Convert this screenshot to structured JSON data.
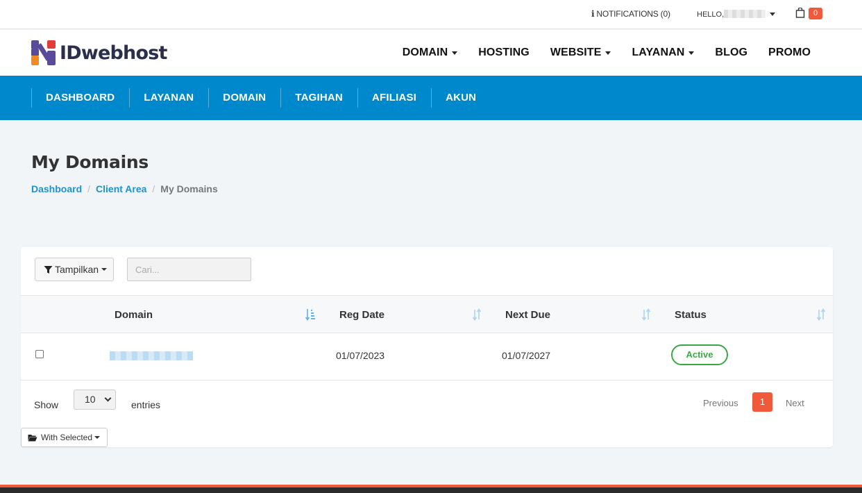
{
  "topbar": {
    "notifications_label": "NOTIFICATIONS (0)",
    "hello_label": "HELLO,",
    "cart_count": "0"
  },
  "header": {
    "logo_text": "IDwebhost",
    "nav": [
      {
        "label": "DOMAIN",
        "dropdown": true
      },
      {
        "label": "HOSTING",
        "dropdown": false
      },
      {
        "label": "WEBSITE",
        "dropdown": true
      },
      {
        "label": "LAYANAN",
        "dropdown": true
      },
      {
        "label": "BLOG",
        "dropdown": false
      },
      {
        "label": "PROMO",
        "dropdown": false
      }
    ]
  },
  "subnav": {
    "items": [
      "DASHBOARD",
      "LAYANAN",
      "DOMAIN",
      "TAGIHAN",
      "AFILIASI",
      "AKUN"
    ]
  },
  "page": {
    "title": "My Domains",
    "breadcrumb": [
      "Dashboard",
      "Client Area",
      "My Domains"
    ]
  },
  "table": {
    "filter_label": "Tampilkan",
    "search_placeholder": "Cari...",
    "columns": [
      "Domain",
      "Reg Date",
      "Next Due",
      "Status"
    ],
    "rows": [
      {
        "reg_date": "01/07/2023",
        "next_due": "01/07/2027",
        "status": "Active"
      }
    ],
    "show_label": "Show",
    "page_size": "10",
    "entries_label": "entries",
    "prev_label": "Previous",
    "current_page": "1",
    "next_label": "Next",
    "with_selected_label": "With Selected"
  },
  "colors": {
    "brand_blue": "#0088cc",
    "accent_orange": "#f05a3a",
    "status_green": "#3aa845",
    "link_blue": "#1e91d0"
  }
}
